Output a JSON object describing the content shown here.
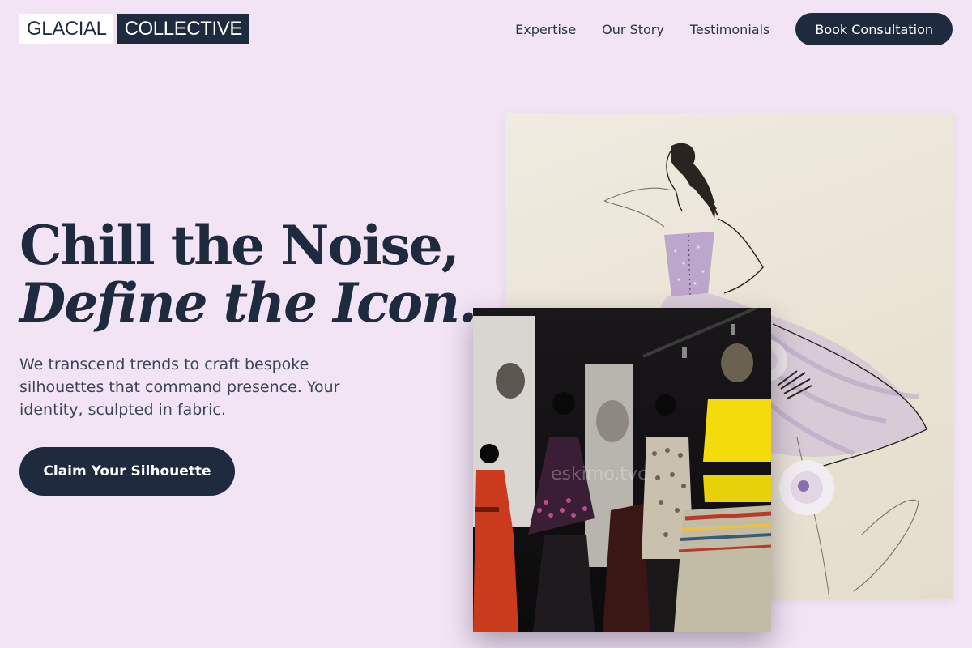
{
  "brand": {
    "part1": "GLACIAL",
    "part2": "COLLECTIVE"
  },
  "nav": {
    "links": [
      "Expertise",
      "Our Story",
      "Testimonials"
    ],
    "cta": "Book Consultation"
  },
  "hero": {
    "title_line1": "Chill the Noise,",
    "title_line2": "Define the Icon.",
    "subtitle": "We transcend trends to craft bespoke silhouettes that command presence. Your identity, sculpted in fabric.",
    "cta": "Claim Your Silhouette"
  },
  "images": {
    "photo_watermark": "eskimo.tvc"
  },
  "colors": {
    "background": "#f2e4f5",
    "navy": "#1e2a3e",
    "sketch_paper": "#ece7da",
    "lavender": "#b49ac8"
  }
}
